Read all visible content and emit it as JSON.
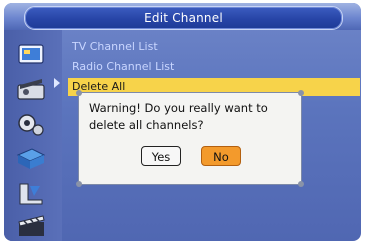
{
  "header": {
    "title": "Edit Channel"
  },
  "menu": {
    "items": [
      {
        "label": "TV Channel List"
      },
      {
        "label": "Radio Channel List"
      },
      {
        "label": "Delete All"
      }
    ]
  },
  "sidebar": {
    "icons": [
      "program-icon",
      "picture-icon",
      "search-icon",
      "time-icon",
      "option-icon",
      "media-icon"
    ]
  },
  "dialog": {
    "message": "Warning! Do you really want to delete all channels?",
    "yes_label": "Yes",
    "no_label": "No"
  },
  "colors": {
    "selected_row": "#f7d34a",
    "focused_button": "#f39a2c",
    "title_pill": "#2745a7"
  }
}
